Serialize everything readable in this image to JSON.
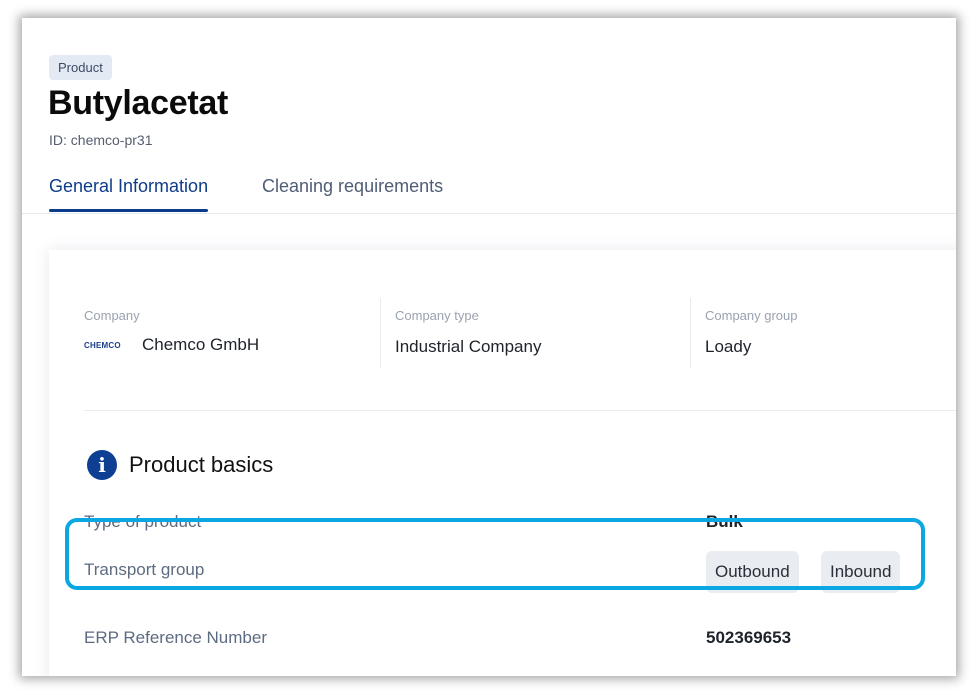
{
  "header": {
    "badge": "Product",
    "title": "Butylacetat",
    "id_text": "ID: chemco-pr31"
  },
  "tabs": [
    {
      "label": "General Information",
      "active": true
    },
    {
      "label": "Cleaning requirements",
      "active": false
    }
  ],
  "company": {
    "company_label": "Company",
    "company_logo": "CHEMCO",
    "company_name": "Chemco GmbH",
    "type_label": "Company type",
    "type_value": "Industrial Company",
    "group_label": "Company group",
    "group_value": "Loady"
  },
  "product_basics": {
    "title": "Product basics",
    "icon": "info-icon",
    "type_label": "Type of product",
    "type_value": "Bulk",
    "transport_label": "Transport group",
    "transport_values": [
      "Outbound",
      "Inbound"
    ],
    "erp_label": "ERP Reference Number",
    "erp_value": "502369653"
  },
  "colors": {
    "accent": "#0d3d8a",
    "highlight": "#0aa7e3"
  }
}
